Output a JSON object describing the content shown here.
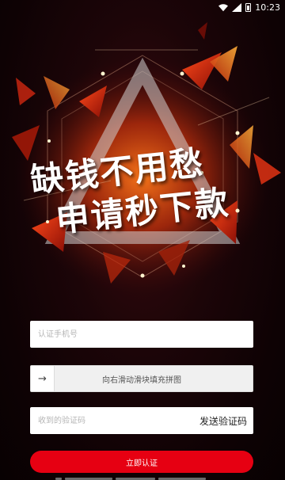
{
  "status_bar": {
    "time": "10:23",
    "icons": [
      "wifi-icon",
      "signal-icon",
      "battery-icon"
    ]
  },
  "hero": {
    "slogan_line1": "缺钱不用愁",
    "slogan_line2": "申请秒下款"
  },
  "form": {
    "phone_placeholder": "认证手机号",
    "slider_icon": "→",
    "slider_text": "向右滑动滑块填充拼图",
    "code_placeholder": "收到的验证码",
    "send_code_label": "发送验证码",
    "submit_label": "立即认证"
  },
  "colors": {
    "accent": "#e60012",
    "background": "#1c0508"
  }
}
